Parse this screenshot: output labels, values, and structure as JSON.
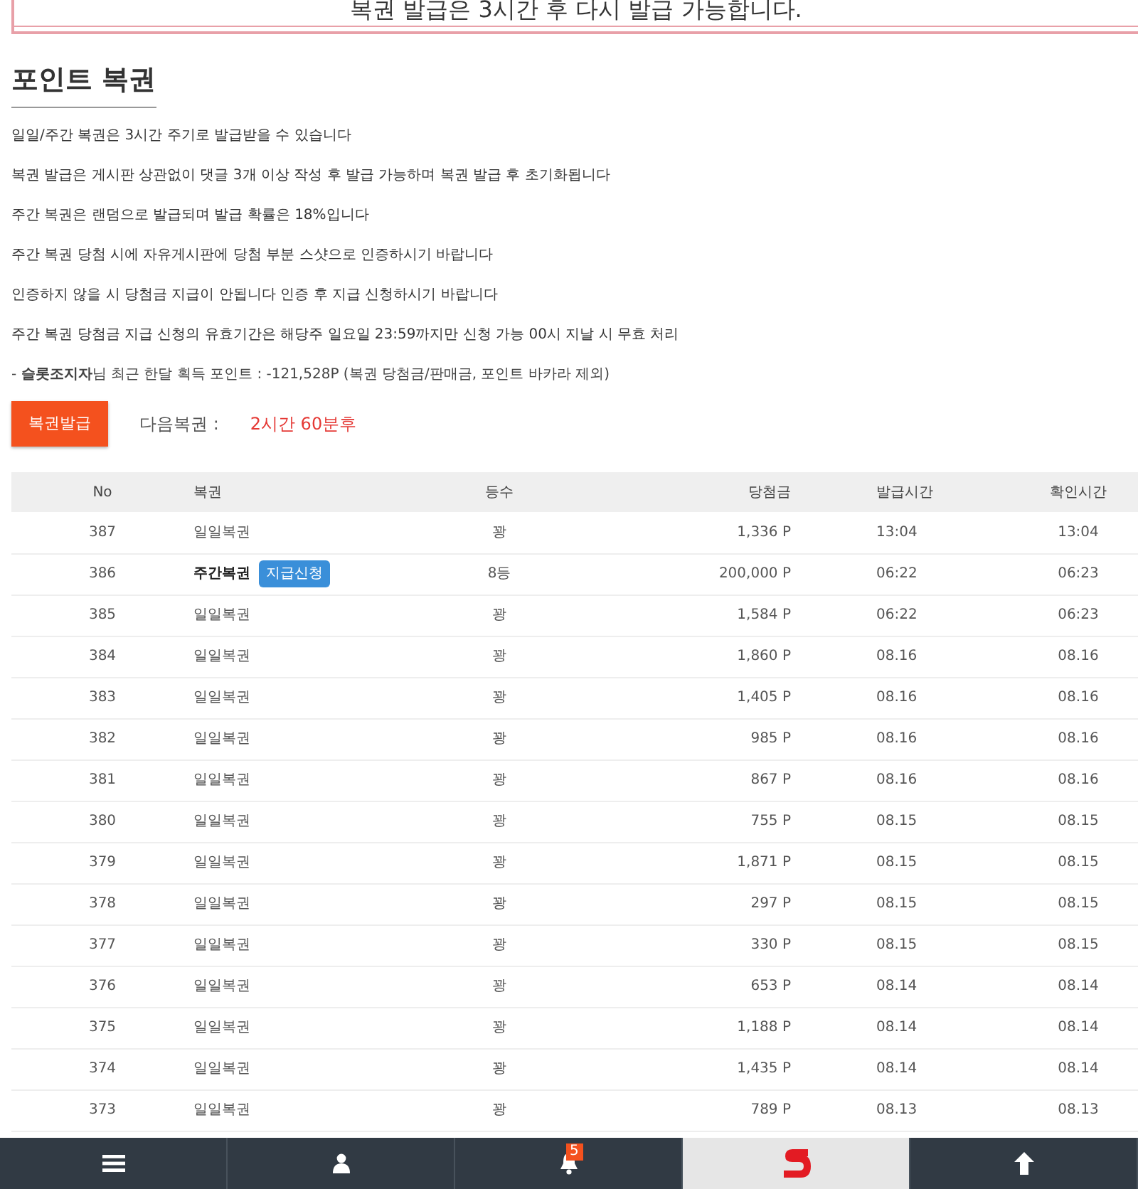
{
  "banner": {
    "text": "복권 발급은 3시간 후 다시 발급 가능합니다."
  },
  "title": "포인트 복권",
  "notes": [
    "일일/주간 복권은 3시간 주기로 발급받을 수 있습니다",
    "복권 발급은 게시판 상관없이 댓글 3개 이상 작성 후 발급 가능하며 복권 발급 후 초기화됩니다",
    "주간 복권은 랜덤으로 발급되며 발급 확률은 18%입니다",
    "주간 복권 당첨 시에 자유게시판에 당첨 부분 스샷으로 인증하시기 바랍니다",
    "인증하지 않을 시 당첨금 지급이 안됩니다 인증 후 지급 신청하시기 바랍니다",
    "주간 복권 당첨금 지급 신청의 유효기간은 해당주 일요일 23:59까지만 신청 가능 00시 지날 시 무효 처리"
  ],
  "summary": "- **슬롯조지자**님 최근 한달 획득 포인트 : -121,528P (복권 당첨금/판매금, 포인트 바카라 제외)",
  "issue_button": "복권발급",
  "next": {
    "label": "다음복권 :",
    "value": "2시간 60분후"
  },
  "table": {
    "columns": [
      "No",
      "복권",
      "등수",
      "당첨금",
      "발급시간",
      "확인시간"
    ],
    "rows": [
      {
        "no": "387",
        "lottery": "일일복권",
        "grade": "꽝",
        "prize": "1,336 P",
        "issued": "13:04",
        "confirmed": "13:04"
      },
      {
        "no": "386",
        "lottery": "주간복권",
        "weekly": true,
        "action": "지급신청",
        "grade": "8등",
        "prize": "200,000 P",
        "issued": "06:22",
        "confirmed": "06:23"
      },
      {
        "no": "385",
        "lottery": "일일복권",
        "grade": "꽝",
        "prize": "1,584 P",
        "issued": "06:22",
        "confirmed": "06:23"
      },
      {
        "no": "384",
        "lottery": "일일복권",
        "grade": "꽝",
        "prize": "1,860 P",
        "issued": "08.16",
        "confirmed": "08.16"
      },
      {
        "no": "383",
        "lottery": "일일복권",
        "grade": "꽝",
        "prize": "1,405 P",
        "issued": "08.16",
        "confirmed": "08.16"
      },
      {
        "no": "382",
        "lottery": "일일복권",
        "grade": "꽝",
        "prize": "985 P",
        "issued": "08.16",
        "confirmed": "08.16"
      },
      {
        "no": "381",
        "lottery": "일일복권",
        "grade": "꽝",
        "prize": "867 P",
        "issued": "08.16",
        "confirmed": "08.16"
      },
      {
        "no": "380",
        "lottery": "일일복권",
        "grade": "꽝",
        "prize": "755 P",
        "issued": "08.15",
        "confirmed": "08.15"
      },
      {
        "no": "379",
        "lottery": "일일복권",
        "grade": "꽝",
        "prize": "1,871 P",
        "issued": "08.15",
        "confirmed": "08.15"
      },
      {
        "no": "378",
        "lottery": "일일복권",
        "grade": "꽝",
        "prize": "297 P",
        "issued": "08.15",
        "confirmed": "08.15"
      },
      {
        "no": "377",
        "lottery": "일일복권",
        "grade": "꽝",
        "prize": "330 P",
        "issued": "08.15",
        "confirmed": "08.15"
      },
      {
        "no": "376",
        "lottery": "일일복권",
        "grade": "꽝",
        "prize": "653 P",
        "issued": "08.14",
        "confirmed": "08.14"
      },
      {
        "no": "375",
        "lottery": "일일복권",
        "grade": "꽝",
        "prize": "1,188 P",
        "issued": "08.14",
        "confirmed": "08.14"
      },
      {
        "no": "374",
        "lottery": "일일복권",
        "grade": "꽝",
        "prize": "1,435 P",
        "issued": "08.14",
        "confirmed": "08.14"
      },
      {
        "no": "373",
        "lottery": "일일복권",
        "grade": "꽝",
        "prize": "789 P",
        "issued": "08.13",
        "confirmed": "08.13"
      }
    ]
  },
  "bottom_nav": [
    {
      "kind": "menu",
      "selected": false
    },
    {
      "kind": "user",
      "selected": false
    },
    {
      "kind": "bell",
      "selected": false,
      "badge": "5"
    },
    {
      "kind": "logo",
      "selected": true
    },
    {
      "kind": "top",
      "selected": false
    }
  ]
}
